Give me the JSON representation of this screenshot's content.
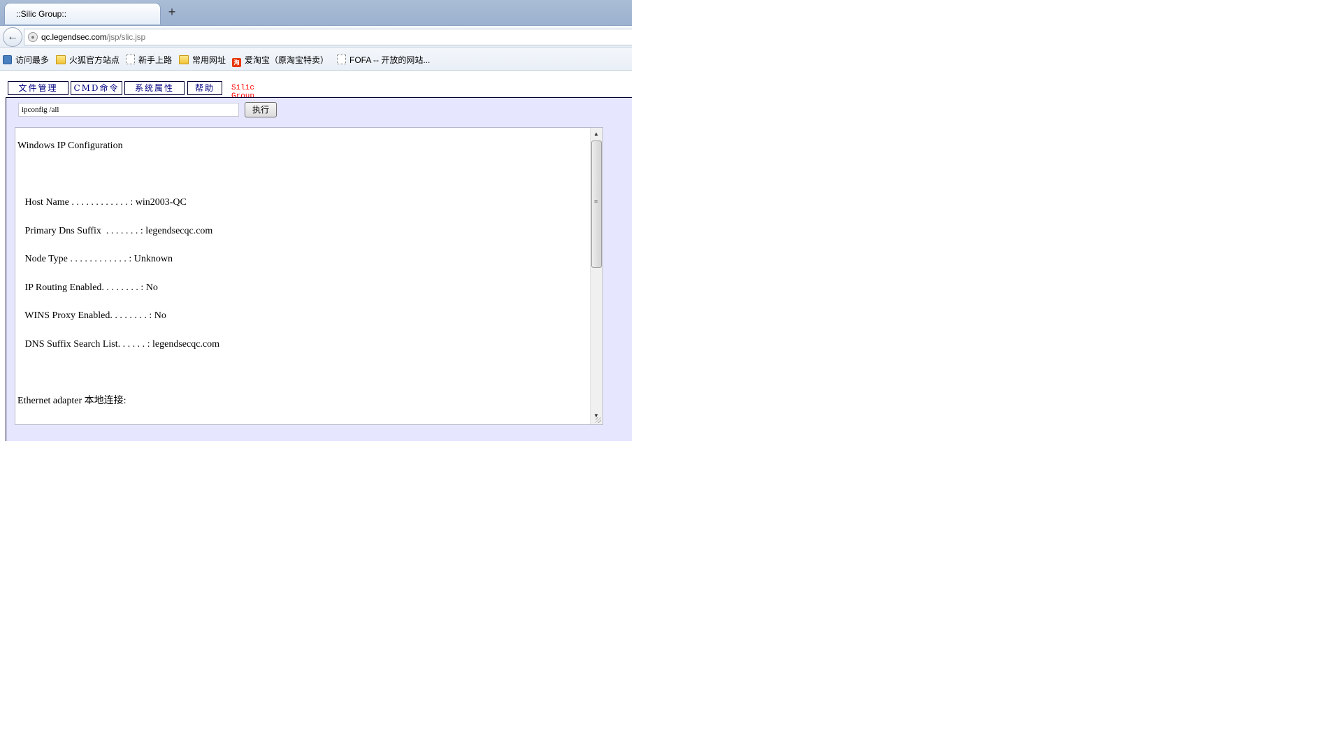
{
  "browser": {
    "tab_title": "::Silic Group::",
    "new_tab_symbol": "+",
    "back_symbol": "🡐",
    "url_domain": "qc.legendsec.com",
    "url_path": "/jsp/slic.jsp",
    "bookmarks": [
      {
        "label": "访问最多",
        "icon": "user-icon"
      },
      {
        "label": "火狐官方站点",
        "icon": "folder-icon"
      },
      {
        "label": "新手上路",
        "icon": "page-icon"
      },
      {
        "label": "常用网址",
        "icon": "folder-icon"
      },
      {
        "label": "爱淘宝（原淘宝特卖）",
        "icon": "taobao-icon"
      },
      {
        "label": "FOFA -- 开放的网站...",
        "icon": "page-icon"
      }
    ]
  },
  "menu": {
    "file_manager": "文件管理",
    "cmd": "CMD命令",
    "system_props": "系统属性",
    "help": "帮助",
    "brand": "Silic Group"
  },
  "command": {
    "value": "ipconfig /all",
    "exec_label": "执行"
  },
  "output": {
    "lines": [
      "Windows IP Configuration",
      "",
      "   Host Name . . . . . . . . . . . . : win2003-QC",
      "   Primary Dns Suffix  . . . . . . . : legendsecqc.com",
      "   Node Type . . . . . . . . . . . . : Unknown",
      "   IP Routing Enabled. . . . . . . . : No",
      "   WINS Proxy Enabled. . . . . . . . : No",
      "   DNS Suffix Search List. . . . . . : legendsecqc.com",
      "",
      "Ethernet adapter 本地连接:"
    ]
  },
  "colors": {
    "panel_bg": "#e6e6ff",
    "menu_text": "#000080",
    "brand_text": "#ff0000"
  }
}
